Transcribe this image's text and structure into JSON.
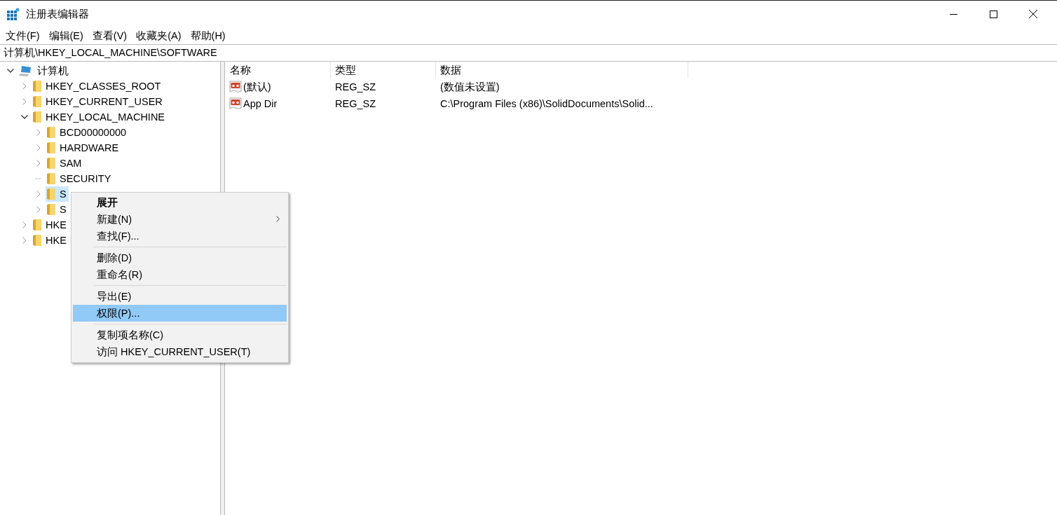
{
  "window": {
    "title": "注册表编辑器"
  },
  "menu_bar": [
    "文件(F)",
    "编辑(E)",
    "查看(V)",
    "收藏夹(A)",
    "帮助(H)"
  ],
  "address": "计算机\\HKEY_LOCAL_MACHINE\\SOFTWARE",
  "tree": [
    {
      "label": "计算机",
      "kind": "computer",
      "expanded": true,
      "selected": false,
      "children": [
        {
          "label": "HKEY_CLASSES_ROOT",
          "kind": "folder",
          "expanded": false,
          "selected": false
        },
        {
          "label": "HKEY_CURRENT_USER",
          "kind": "folder",
          "expanded": false,
          "selected": false
        },
        {
          "label": "HKEY_LOCAL_MACHINE",
          "kind": "folder",
          "expanded": true,
          "selected": false,
          "children": [
            {
              "label": "BCD00000000",
              "kind": "folder",
              "expanded": false,
              "selected": false
            },
            {
              "label": "HARDWARE",
              "kind": "folder",
              "expanded": false,
              "selected": false
            },
            {
              "label": "SAM",
              "kind": "folder",
              "expanded": false,
              "selected": false
            },
            {
              "label": "SECURITY",
              "kind": "leaf",
              "selected": false
            },
            {
              "label": "S",
              "kind": "folder",
              "expanded": false,
              "selected": true
            },
            {
              "label": "S",
              "kind": "folder",
              "expanded": false,
              "selected": false
            }
          ]
        },
        {
          "label": "HKE",
          "kind": "folder",
          "expanded": false,
          "selected": false
        },
        {
          "label": "HKE",
          "kind": "folder",
          "expanded": false,
          "selected": false
        }
      ]
    }
  ],
  "table": {
    "columns": [
      "名称",
      "类型",
      "数据"
    ],
    "rows": [
      {
        "name": "(默认)",
        "type": "REG_SZ",
        "data": "(数值未设置)"
      },
      {
        "name": "App Dir",
        "type": "REG_SZ",
        "data": "C:\\Program Files (x86)\\SolidDocuments\\Solid..."
      }
    ]
  },
  "context_menu": [
    {
      "kind": "item",
      "label": "展开",
      "bold": true,
      "submenu": false,
      "selected": false
    },
    {
      "kind": "item",
      "label": "新建(N)",
      "bold": false,
      "submenu": true,
      "selected": false
    },
    {
      "kind": "item",
      "label": "查找(F)...",
      "bold": false,
      "submenu": false,
      "selected": false
    },
    {
      "kind": "separator"
    },
    {
      "kind": "item",
      "label": "删除(D)",
      "bold": false,
      "submenu": false,
      "selected": false
    },
    {
      "kind": "item",
      "label": "重命名(R)",
      "bold": false,
      "submenu": false,
      "selected": false
    },
    {
      "kind": "separator"
    },
    {
      "kind": "item",
      "label": "导出(E)",
      "bold": false,
      "submenu": false,
      "selected": false
    },
    {
      "kind": "item",
      "label": "权限(P)...",
      "bold": false,
      "submenu": false,
      "selected": true
    },
    {
      "kind": "separator"
    },
    {
      "kind": "item",
      "label": "复制项名称(C)",
      "bold": false,
      "submenu": false,
      "selected": false
    },
    {
      "kind": "item",
      "label": "访问 HKEY_CURRENT_USER(T)",
      "bold": false,
      "submenu": false,
      "selected": false
    }
  ]
}
